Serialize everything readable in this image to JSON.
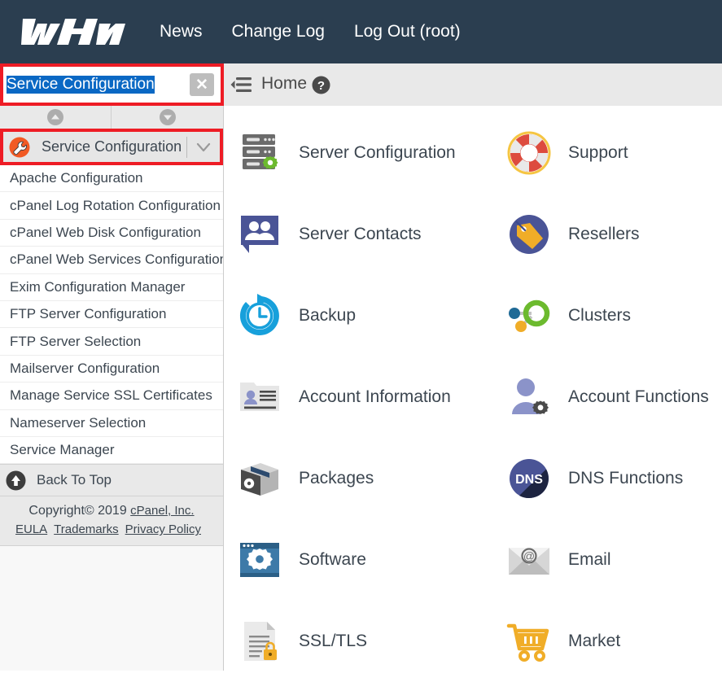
{
  "header": {
    "logo_text": "WHM",
    "nav": [
      {
        "label": "News",
        "name": "nav-news"
      },
      {
        "label": "Change Log",
        "name": "nav-change-log"
      },
      {
        "label": "Log Out (root)",
        "name": "nav-log-out"
      }
    ],
    "background_color": "#2b3e50"
  },
  "subbar": {
    "search_value": "Service Configuration",
    "search_placeholder": "Search",
    "clear_icon": "close-icon",
    "collapse_icon": "collapse-sidebar-icon",
    "breadcrumb_home": "Home",
    "help_icon": "help-icon",
    "highlight_color": "#ee1c25",
    "selection_color": "#0a68c4"
  },
  "sidebar": {
    "scroll_up_icon": "chevron-up-circle-icon",
    "scroll_down_icon": "chevron-down-circle-icon",
    "group": {
      "icon": "wrench-icon",
      "title": "Service Configuration",
      "chevron_icon": "chevron-down-icon"
    },
    "items": [
      {
        "label": "Apache Configuration"
      },
      {
        "label": "cPanel Log Rotation Configuration"
      },
      {
        "label": "cPanel Web Disk Configuration"
      },
      {
        "label": "cPanel Web Services Configuration"
      },
      {
        "label": "Exim Configuration Manager"
      },
      {
        "label": "FTP Server Configuration"
      },
      {
        "label": "FTP Server Selection"
      },
      {
        "label": "Mailserver Configuration"
      },
      {
        "label": "Manage Service SSL Certificates"
      },
      {
        "label": "Nameserver Selection"
      },
      {
        "label": "Service Manager"
      }
    ],
    "back_to_top": {
      "label": "Back To Top",
      "icon": "arrow-up-circle-icon"
    },
    "footer": {
      "copyright_prefix": "Copyright© 2019 ",
      "company": "cPanel, Inc.",
      "links": [
        {
          "label": "EULA"
        },
        {
          "label": "Trademarks"
        },
        {
          "label": "Privacy Policy"
        }
      ]
    }
  },
  "main": {
    "rows": [
      {
        "left": {
          "label": "Server Configuration",
          "icon": "server-gear-icon"
        },
        "right": {
          "label": "Support",
          "icon": "life-ring-icon"
        }
      },
      {
        "left": {
          "label": "Server Contacts",
          "icon": "people-speech-bubble-icon"
        },
        "right": {
          "label": "Resellers",
          "icon": "price-tag-circle-icon"
        }
      },
      {
        "left": {
          "label": "Backup",
          "icon": "clock-restore-icon"
        },
        "right": {
          "label": "Clusters",
          "icon": "cluster-nodes-icon"
        }
      },
      {
        "left": {
          "label": "Account Information",
          "icon": "contact-card-icon"
        },
        "right": {
          "label": "Account Functions",
          "icon": "user-gear-icon"
        }
      },
      {
        "left": {
          "label": "Packages",
          "icon": "box-gear-icon"
        },
        "right": {
          "label": "DNS Functions",
          "icon": "dns-circle-icon"
        }
      },
      {
        "left": {
          "label": "Software",
          "icon": "window-gear-icon"
        },
        "right": {
          "label": "Email",
          "icon": "envelope-at-icon"
        }
      },
      {
        "left": {
          "label": "SSL/TLS",
          "icon": "document-lock-icon"
        },
        "right": {
          "label": "Market",
          "icon": "shopping-cart-icon"
        }
      }
    ]
  }
}
